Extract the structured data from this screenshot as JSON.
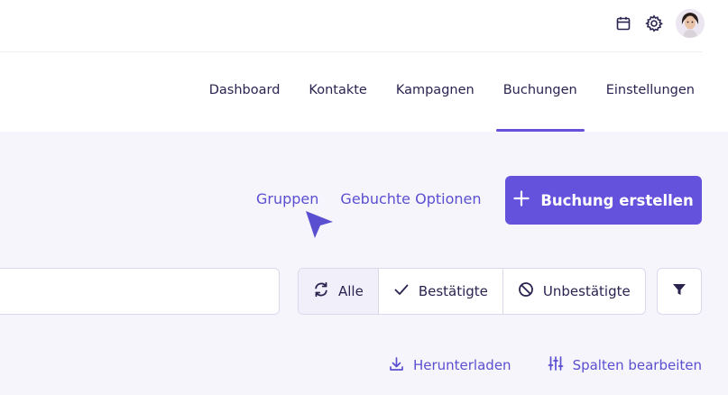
{
  "nav": {
    "items": [
      {
        "label": "Dashboard"
      },
      {
        "label": "Kontakte"
      },
      {
        "label": "Kampagnen"
      },
      {
        "label": "Buchungen"
      },
      {
        "label": "Einstellungen"
      }
    ],
    "active": "Buchungen"
  },
  "top_icons": [
    "calendar-icon",
    "gear-icon",
    "avatar"
  ],
  "links": {
    "groups": "Gruppen",
    "booked_options": "Gebuchte Optionen"
  },
  "primary_button": {
    "label": "Buchung erstellen",
    "icon": "plus-icon"
  },
  "search": {
    "value": "",
    "placeholder": ""
  },
  "segments": [
    {
      "label": "Alle",
      "icon": "refresh-icon",
      "selected": true
    },
    {
      "label": "Bestätigte",
      "icon": "check-icon",
      "selected": false
    },
    {
      "label": "Unbestätigte",
      "icon": "block-icon",
      "selected": false
    }
  ],
  "filter_button": {
    "icon": "filter-icon"
  },
  "actions": {
    "download": "Herunterladen",
    "edit_columns": "Spalten bearbeiten"
  },
  "colors": {
    "accent": "#6451dc",
    "link": "#5b4fd1",
    "text": "#2a2350",
    "page_bg": "#f6f5fb"
  }
}
